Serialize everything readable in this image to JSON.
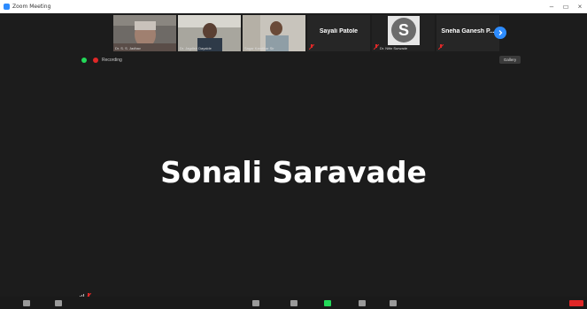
{
  "window": {
    "title": "Zoom Meeting",
    "controls": [
      "–",
      "▭",
      "×"
    ]
  },
  "gallery": {
    "tiles": [
      {
        "type": "video",
        "name": "Dr. S. S. Jadhav",
        "muted": false
      },
      {
        "type": "video",
        "name": "Dr. Jagdish Dayalde",
        "muted": false
      },
      {
        "type": "video",
        "name": "Sagar Kamtikar Sir",
        "muted": false
      },
      {
        "type": "text",
        "name": "Sayali Patole",
        "muted": true
      },
      {
        "type": "avatar",
        "name": "Dr. Nitin Surwade",
        "letter": "S",
        "muted": true
      },
      {
        "type": "text",
        "name": "Sneha Ganesh P...",
        "muted": true
      }
    ],
    "next_page_icon": "chevron-right-icon"
  },
  "status": {
    "security_icon": "shield-check-icon",
    "recording_label": "Recording",
    "view_label": "Gallery"
  },
  "active_speaker": {
    "name": "Sonali Saravade"
  },
  "colors": {
    "accent": "#2d8cff",
    "recording": "#e02828",
    "secure": "#23d959",
    "background": "#1c1c1c"
  }
}
